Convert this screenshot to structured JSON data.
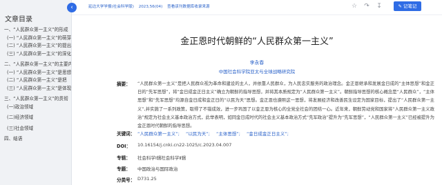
{
  "sidebar": {
    "title": "文章目录",
    "items": [
      {
        "label": "一、“人民群众第一主义”的形成"
      },
      {
        "label": "(一) “人民群众第一主义”的萌芽"
      },
      {
        "label": "(二) “人民群众第一主义”的提出"
      },
      {
        "label": "(三) “人民群众第一主义”的深化"
      },
      {
        "label": "二、“人民群众第一主义”的主要内容"
      },
      {
        "label": "(一) “人民群众第一主义”是思想"
      },
      {
        "label": "(二) “人民群众第一主义”是把"
      },
      {
        "label": "(三) “人民群众第一主义”是体现"
      },
      {
        "label": "三、“人民群众第一主义”的贯彻"
      },
      {
        "label": "(一)政治领域"
      },
      {
        "label": "(二)经济领域"
      },
      {
        "label": "(三)社会领域"
      },
      {
        "label": "四、结语"
      }
    ]
  },
  "topbar": {
    "source": [
      "延边大学学报(社会科学版)",
      "2023,56(04)",
      "查看该刊数据库收录来源"
    ],
    "note_button": "记笔记"
  },
  "article": {
    "title": "金正恩时代朝鲜的“人民群众第一主义”",
    "author": "李永春",
    "affiliation": "中国社会科学院亚太与全球战略研究院",
    "abstract_label": "摘要：",
    "abstract": "“人民群众第一主义”是把人民群众视为革命和建设的主人，并依靠人民群众，为人民忠实服务的政治理念。金正恩继承和发展金日成的“主体思想”和金正日的“先军思想”，将“金日成金正日主义”确立为朝鲜的指导思想，并将其本质规定为“人民群众第一主义”。朝鲜指导思想的核心概念是“人民群众”，“主体思想”和“先军思想”均源自金日成和金正日的“以民为天”思想。金正恩也遵照这一思想，将发展经济和改善民生设定为国家目标，提出了“人民群众第一主义”,并实施了一系列政策，取得了不错成效，进一步巩固了以金正恩为核心的全党全社会的团结一心。近年来，朝鲜劳动党和国家将“人民群众第一主义政治”规定为社会主义基本政治方式，此举表明，如同金日成时代的社会主义基本政治方式“先军政治”提升为“先军思想”，“人民群众第一主义”已经被提升为金正恩时代朝鲜的指导思想。",
    "keywords_label": "关键词：",
    "keywords": [
      "“人民群众第一主义”;",
      "“以民为天”;",
      "“主体思想”;",
      "“金日成金正日主义”;"
    ],
    "doi_label": "DOI：",
    "doi": "10.16154/j.cnki.cn22-1025/c.2023.04.007",
    "category_label": "专辑：",
    "category": "社会科学Ⅰ辑社会科学Ⅱ辑",
    "topic_label": "专题：",
    "topic": "中国政治与国际政治",
    "class_label": "分类号：",
    "class_no": "D731.25"
  },
  "colors": {
    "accent": "#2f6ce5",
    "link": "#2a62c9",
    "sidebar_bg": "#f0f2f5"
  },
  "icons": [
    "collapse-chevron-icon",
    "star-icon",
    "share-icon",
    "download-icon",
    "note-icon"
  ]
}
